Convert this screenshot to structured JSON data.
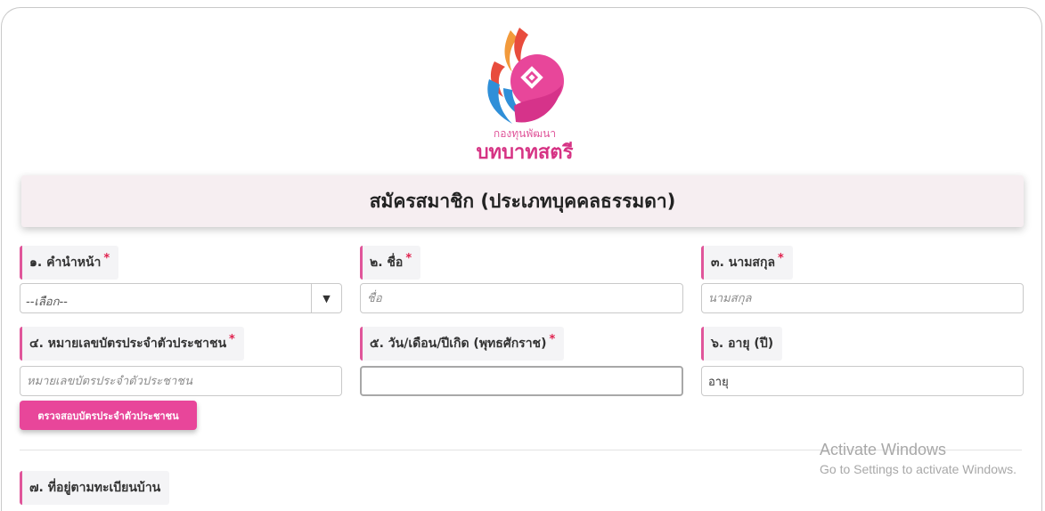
{
  "logo": {
    "small_text": "กองทุนพัฒนา",
    "big_text": "บทบาทสตรี",
    "colors": {
      "pink": "#e0559a",
      "orange": "#f29a3b",
      "red": "#e84c3d",
      "blue": "#2f8fd8"
    }
  },
  "form_title": "สมัครสมาชิก (ประเภทบุคคลธรรมดา)",
  "fields": {
    "prefix": {
      "label": "๑. คำนำหน้า",
      "required": "*",
      "selected": "--เลือก--",
      "caret": "▼"
    },
    "first_name": {
      "label": "๒. ชื่อ",
      "required": "*",
      "placeholder": "ชื่อ"
    },
    "last_name": {
      "label": "๓. นามสกุล",
      "required": "*",
      "placeholder": "นามสกุล"
    },
    "id_card": {
      "label": "๔. หมายเลขบัตรประจำตัวประชาชน",
      "required": "*",
      "placeholder": "หมายเลขบัตรประจำตัวประชาชน"
    },
    "birth_date": {
      "label": "๕. วัน/เดือน/ปีเกิด (พุทธศักราช)",
      "required": "*",
      "value": ""
    },
    "age": {
      "label": "๖. อายุ (ปี)",
      "value": "อายุ"
    },
    "address": {
      "label": "๗. ที่อยู่ตามทะเบียนบ้าน"
    }
  },
  "verify_button": "ตรวจสอบบัตรประจำตัวประชาชน",
  "watermark": {
    "line1": "Activate Windows",
    "line2": "Go to Settings to activate Windows."
  },
  "colors": {
    "accent": "#e8469a",
    "label_bg": "#f4f4f6",
    "title_bg": "#f6eef1",
    "required": "#e0224f"
  }
}
